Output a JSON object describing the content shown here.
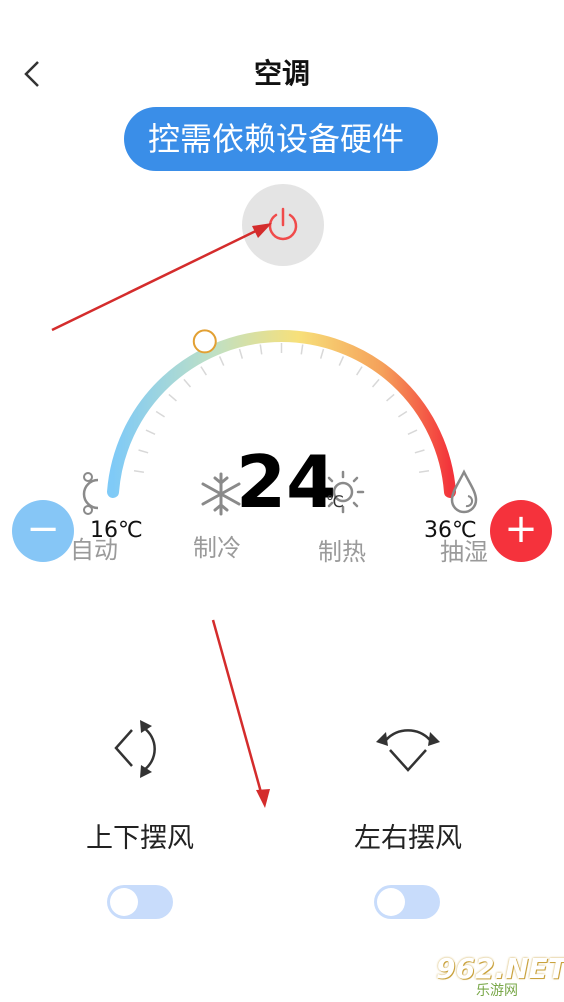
{
  "header": {
    "title": "空调",
    "back_icon": "chevron-left-icon"
  },
  "banner": {
    "text": "控需依赖设备硬件"
  },
  "power": {
    "icon": "power-icon",
    "color": "#f04b4b"
  },
  "thermostat": {
    "temperature": "24",
    "unit": "℃",
    "min_label": "16℃",
    "max_label": "36℃",
    "gradient": [
      "#7fcaf7",
      "#bfe0c4",
      "#f7e07a",
      "#f5a05a",
      "#f3343b"
    ],
    "slider_fraction": 0.2
  },
  "modes": [
    {
      "label": "自动",
      "icon": "auto-cycle-icon"
    },
    {
      "label": "制冷",
      "icon": "snowflake-icon"
    },
    {
      "label": "制热",
      "icon": "sun-icon"
    },
    {
      "label": "抽湿",
      "icon": "droplet-icon"
    }
  ],
  "buttons": {
    "minus": "−",
    "plus": "+"
  },
  "swing": {
    "vertical": {
      "label": "上下摆风",
      "icon": "vertical-swing-icon",
      "on": false
    },
    "horizontal": {
      "label": "左右摆风",
      "icon": "horizontal-swing-icon",
      "on": false
    }
  },
  "watermark": {
    "brand": "962.NET",
    "sub": "乐游网"
  }
}
